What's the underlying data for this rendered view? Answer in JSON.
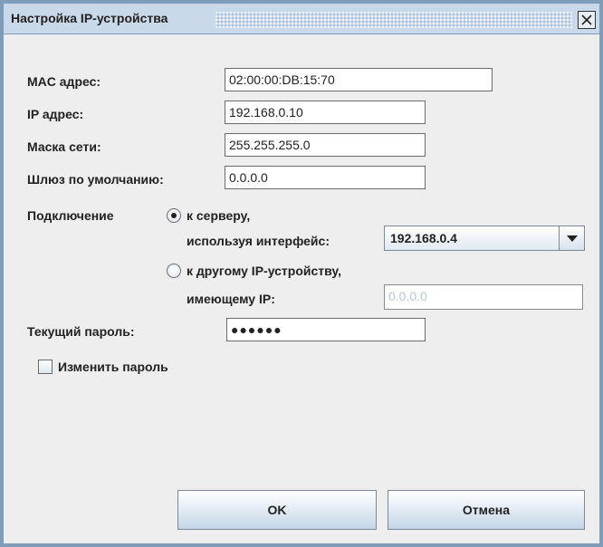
{
  "window": {
    "title": "Настройка IP-устройства"
  },
  "form": {
    "mac_label": "MAC адрес:",
    "mac_value": "02:00:00:DB:15:70",
    "ip_label": "IP адрес:",
    "ip_value": "192.168.0.10",
    "mask_label": "Маска сети:",
    "mask_value": "255.255.255.0",
    "gateway_label": "Шлюз по умолчанию:",
    "gateway_value": "0.0.0.0"
  },
  "connection": {
    "label": "Подключение",
    "option_server_label": "к серверу,",
    "interface_label": "используя интерфейс:",
    "interface_value": "192.168.0.4",
    "option_device_label": "к другому IP-устройству,",
    "device_ip_label": "имеющему IP:",
    "device_ip_value": "0.0.0.0",
    "selected": "server"
  },
  "password": {
    "label": "Текущий пароль:",
    "value": "●●●●●●",
    "change_label": "Изменить пароль",
    "change_checked": false
  },
  "buttons": {
    "ok": "OK",
    "cancel": "Отмена"
  },
  "icons": {
    "close": "close-icon",
    "dropdown": "chevron-down-icon"
  }
}
